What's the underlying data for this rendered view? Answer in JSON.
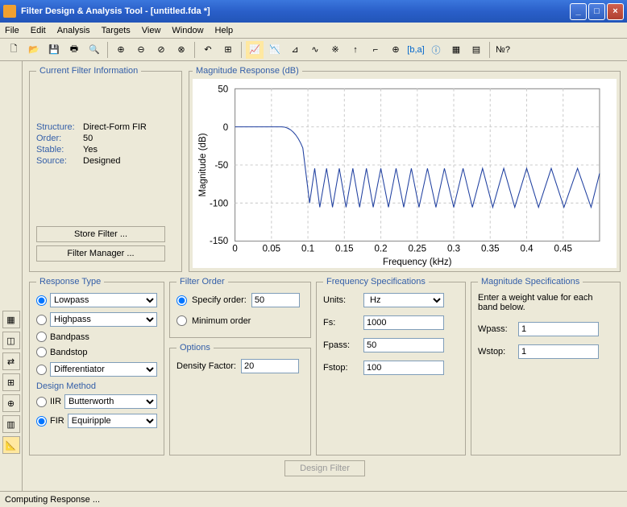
{
  "window": {
    "title": "Filter Design & Analysis Tool -  [untitled.fda *]"
  },
  "menu": {
    "file": "File",
    "edit": "Edit",
    "analysis": "Analysis",
    "targets": "Targets",
    "view": "View",
    "window": "Window",
    "help": "Help"
  },
  "filter_info": {
    "legend": "Current Filter Information",
    "structure_label": "Structure:",
    "structure": "Direct-Form FIR",
    "order_label": "Order:",
    "order": "50",
    "stable_label": "Stable:",
    "stable": "Yes",
    "source_label": "Source:",
    "source": "Designed",
    "store_btn": "Store Filter ...",
    "manager_btn": "Filter Manager ..."
  },
  "mag_response": {
    "legend": "Magnitude Response (dB)"
  },
  "response_type": {
    "legend": "Response Type",
    "lowpass": "Lowpass",
    "highpass": "Highpass",
    "bandpass": "Bandpass",
    "bandstop": "Bandstop",
    "differentiator": "Differentiator",
    "design_method_label": "Design Method",
    "iir": "IIR",
    "iir_sel": "Butterworth",
    "fir": "FIR",
    "fir_sel": "Equiripple"
  },
  "filter_order": {
    "legend": "Filter Order",
    "specify": "Specify order:",
    "specify_val": "50",
    "minimum": "Minimum order"
  },
  "options": {
    "legend": "Options",
    "density_label": "Density Factor:",
    "density_val": "20"
  },
  "freq_spec": {
    "legend": "Frequency Specifications",
    "units_label": "Units:",
    "units": "Hz",
    "fs_label": "Fs:",
    "fs": "1000",
    "fpass_label": "Fpass:",
    "fpass": "50",
    "fstop_label": "Fstop:",
    "fstop": "100"
  },
  "mag_spec": {
    "legend": "Magnitude Specifications",
    "hint": "Enter a weight value for each band below.",
    "wpass_label": "Wpass:",
    "wpass": "1",
    "wstop_label": "Wstop:",
    "wstop": "1"
  },
  "design_filter_btn": "Design Filter",
  "status": "Computing Response ...",
  "chart_data": {
    "type": "line",
    "xlabel": "Frequency (kHz)",
    "ylabel": "Magnitude (dB)",
    "xlim": [
      0,
      0.5
    ],
    "ylim": [
      -150,
      50
    ],
    "xticks": [
      0,
      0.05,
      0.1,
      0.15,
      0.2,
      0.25,
      0.3,
      0.35,
      0.4,
      0.45
    ],
    "yticks": [
      50,
      0,
      -50,
      -100,
      -150
    ],
    "series": [
      {
        "name": "response",
        "description": "0 dB passband 0–~0.07; transition; stopband ripple peaks ~-55 dB, nulls ~-100 to -130 dB, ~19 lobes between 0.1–0.5"
      }
    ]
  }
}
